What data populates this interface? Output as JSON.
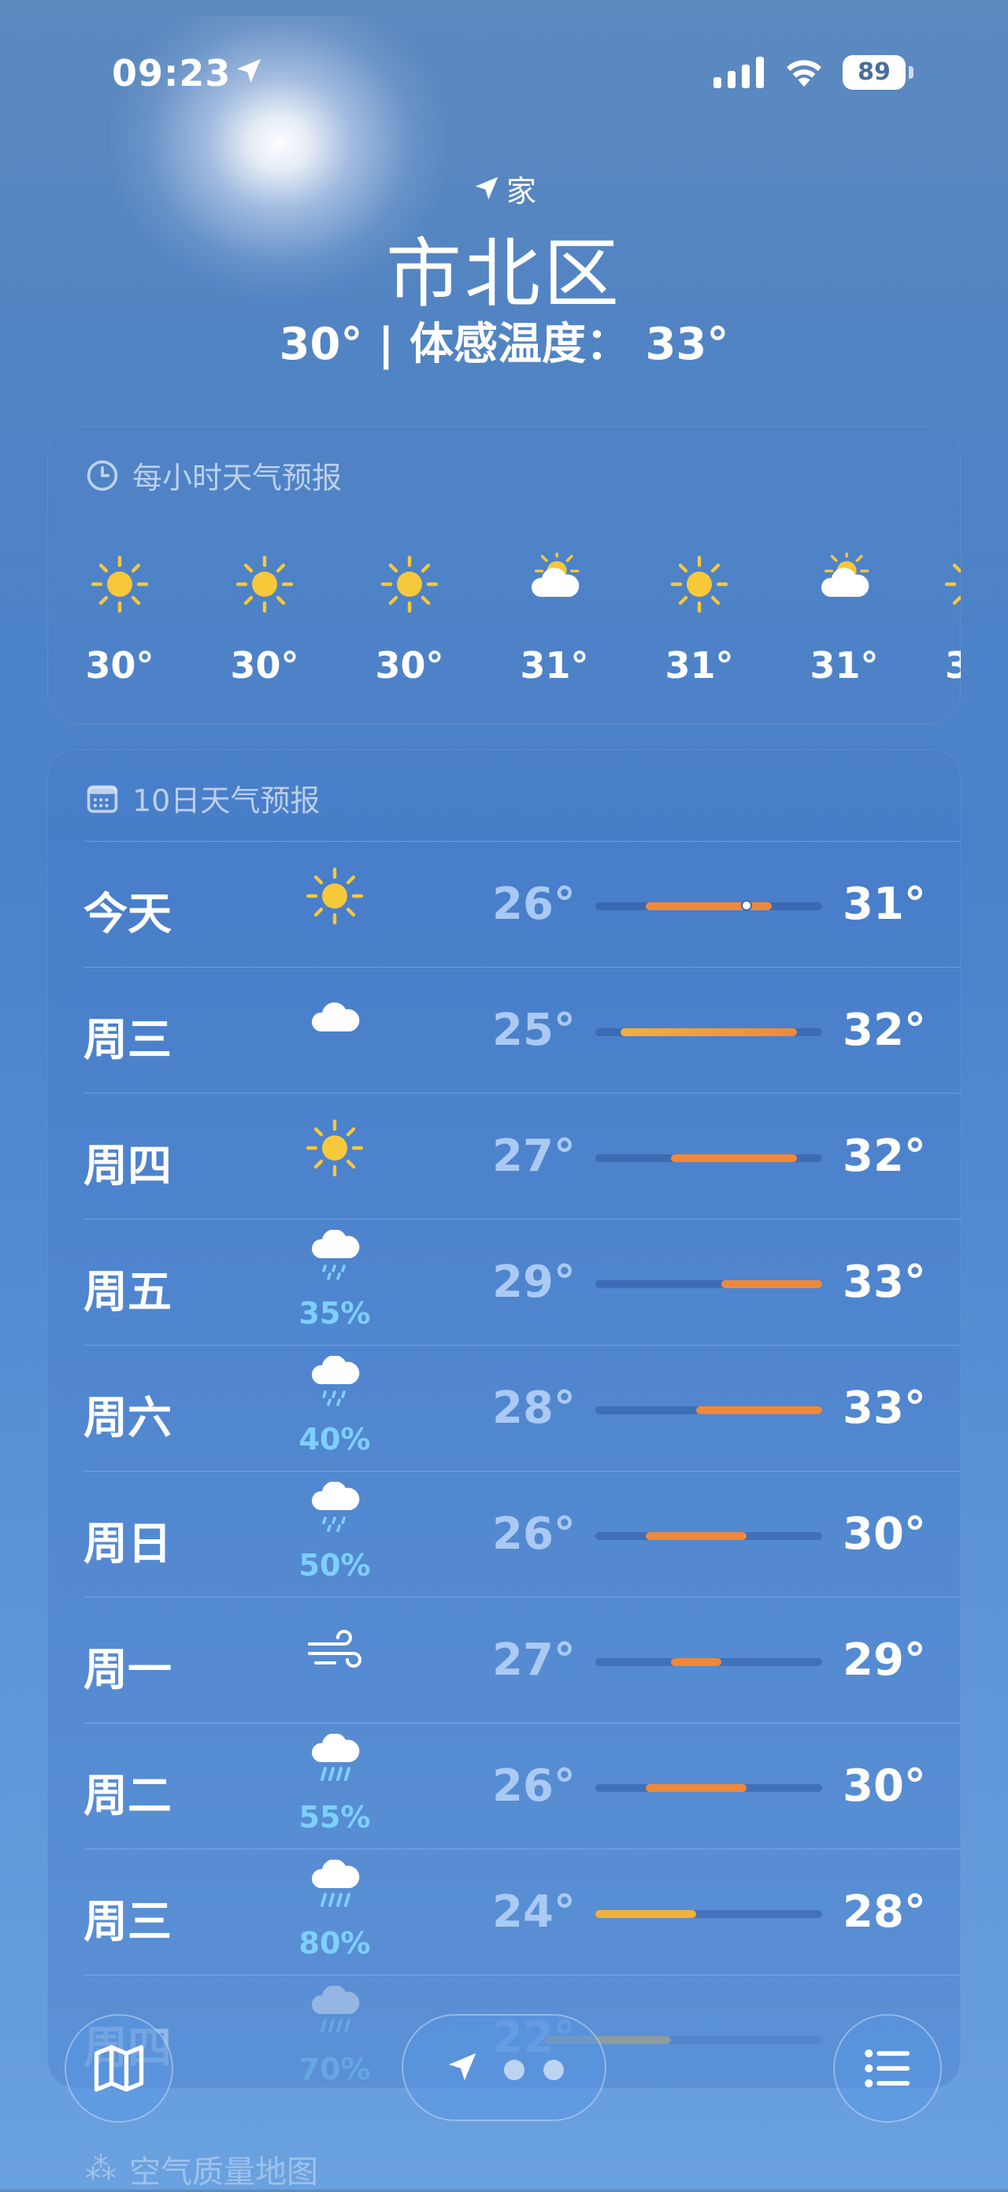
{
  "status_bar": {
    "time": "09:23",
    "battery": "89"
  },
  "header": {
    "location_label": "家",
    "city": "市北区",
    "current_temp_line": "30° | 体感温度： 33°"
  },
  "hourly": {
    "title": "每小时天气预报",
    "items": [
      {
        "icon": "sun-icon",
        "temp": "30°"
      },
      {
        "icon": "sun-icon",
        "temp": "30°"
      },
      {
        "icon": "sun-icon",
        "temp": "30°"
      },
      {
        "icon": "partly-cloudy-icon",
        "temp": "31°"
      },
      {
        "icon": "sun-icon",
        "temp": "31°"
      },
      {
        "icon": "partly-cloudy-icon",
        "temp": "31°"
      },
      {
        "icon": "sun-icon",
        "temp": "3"
      }
    ]
  },
  "daily": {
    "title": "10日天气预报",
    "range_min": 24,
    "range_max": 33,
    "days": [
      {
        "name": "今天",
        "icon": "sun-icon",
        "precip": "",
        "low": "26°",
        "high": "31°",
        "low_v": 26,
        "high_v": 31,
        "now_v": 30
      },
      {
        "name": "周三",
        "icon": "cloud-icon",
        "precip": "",
        "low": "25°",
        "high": "32°",
        "low_v": 25,
        "high_v": 32
      },
      {
        "name": "周四",
        "icon": "sun-icon",
        "precip": "",
        "low": "27°",
        "high": "32°",
        "low_v": 27,
        "high_v": 32
      },
      {
        "name": "周五",
        "icon": "cloud-drizzle-icon",
        "precip": "35%",
        "low": "29°",
        "high": "33°",
        "low_v": 29,
        "high_v": 33
      },
      {
        "name": "周六",
        "icon": "cloud-drizzle-icon",
        "precip": "40%",
        "low": "28°",
        "high": "33°",
        "low_v": 28,
        "high_v": 33
      },
      {
        "name": "周日",
        "icon": "cloud-drizzle-icon",
        "precip": "50%",
        "low": "26°",
        "high": "30°",
        "low_v": 26,
        "high_v": 30
      },
      {
        "name": "周一",
        "icon": "wind-icon",
        "precip": "",
        "low": "27°",
        "high": "29°",
        "low_v": 27,
        "high_v": 29
      },
      {
        "name": "周二",
        "icon": "cloud-rain-icon",
        "precip": "55%",
        "low": "26°",
        "high": "30°",
        "low_v": 26,
        "high_v": 30
      },
      {
        "name": "周三",
        "icon": "cloud-rain-icon",
        "precip": "80%",
        "low": "24°",
        "high": "28°",
        "low_v": 24,
        "high_v": 28
      },
      {
        "name": "周四",
        "icon": "cloud-rain-icon",
        "precip": "70%",
        "low": "22°",
        "high": "",
        "low_v": 22,
        "high_v": 27
      }
    ]
  },
  "bottom": {
    "air_quality_label": "空气质量地图"
  },
  "colors": {
    "bar_warm": "#f0883a",
    "bar_mild": "#f3b03b",
    "precip": "#7dd0ff"
  }
}
